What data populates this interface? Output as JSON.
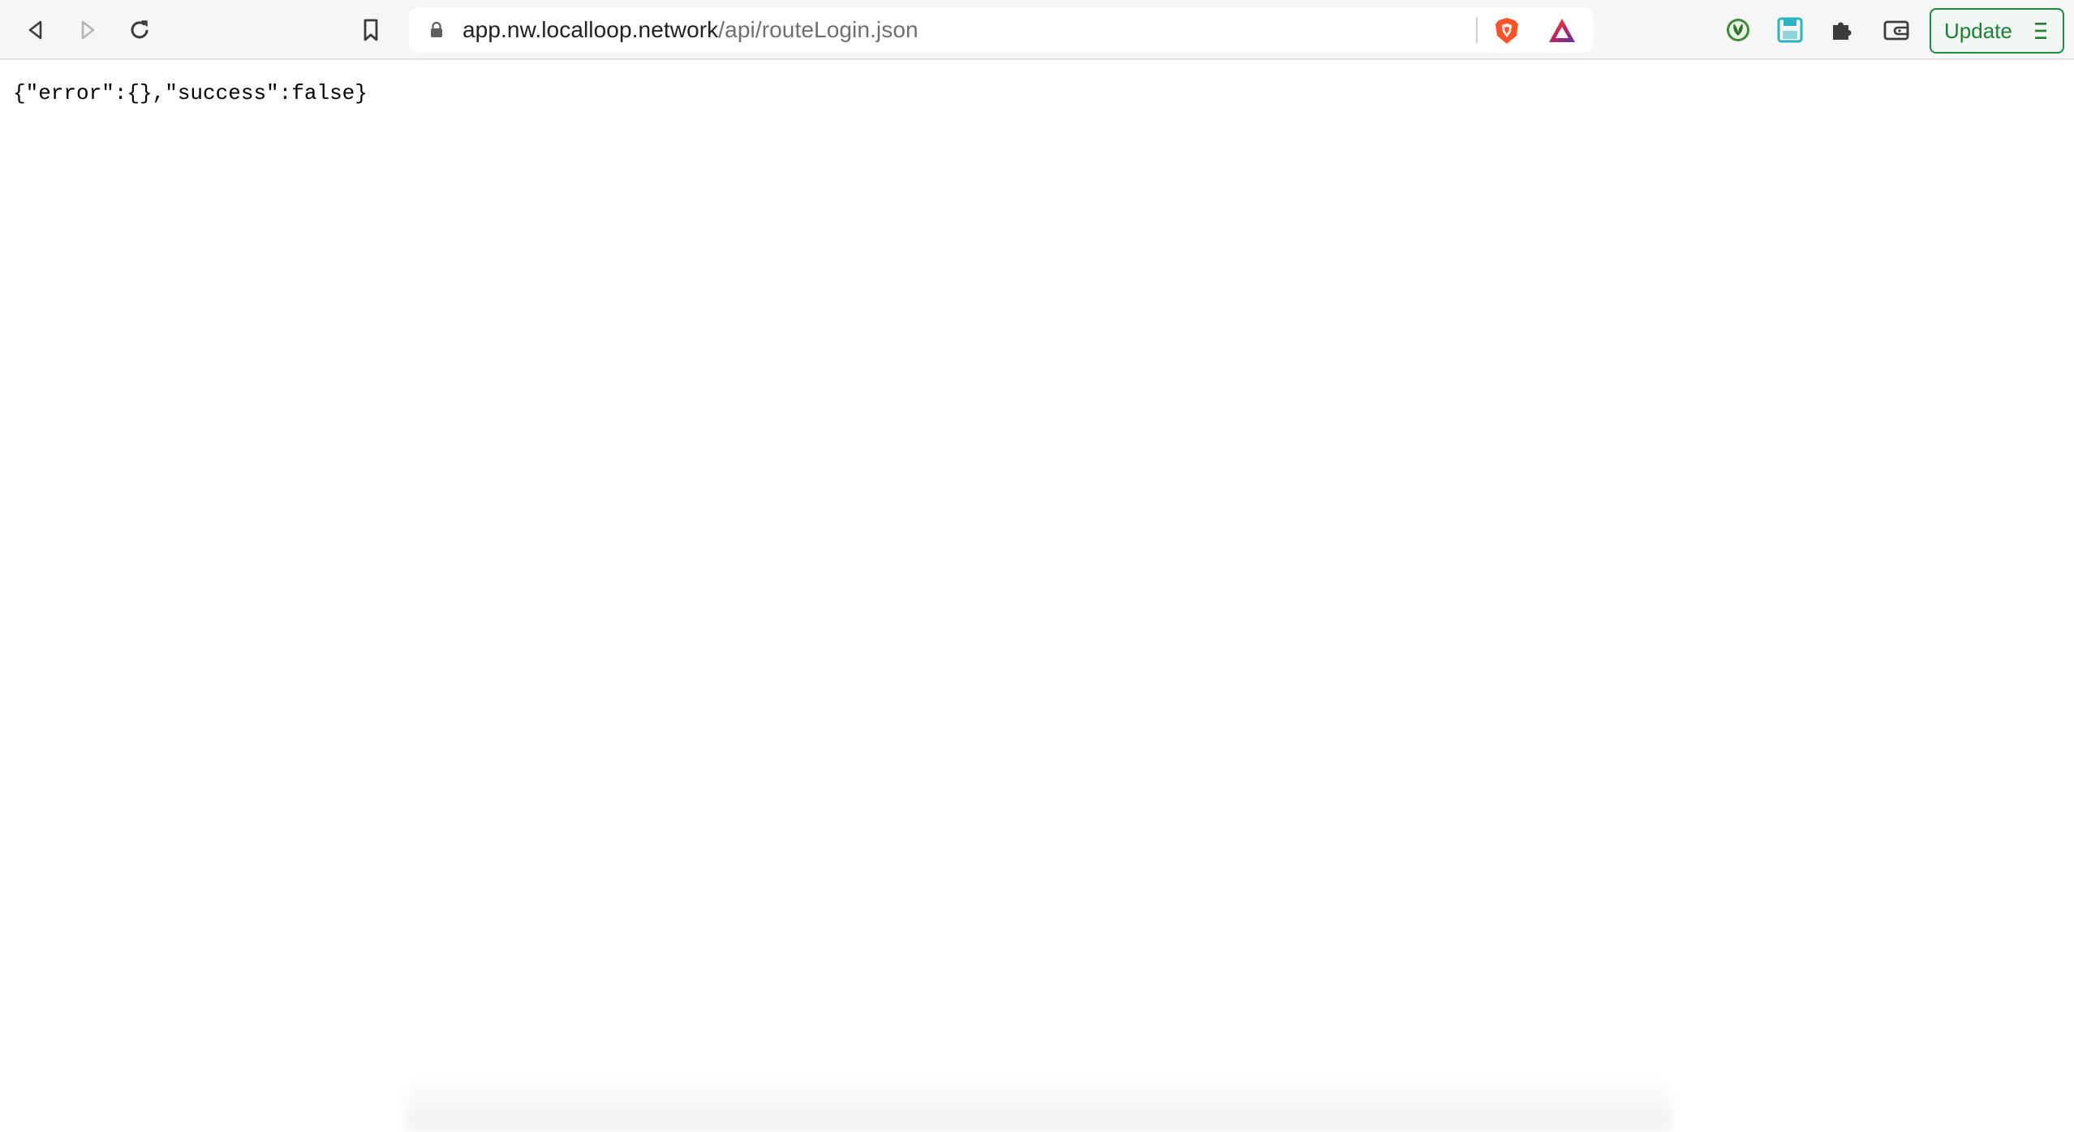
{
  "browser": {
    "url_host": "app.nw.localloop.network",
    "url_path": "/api/routeLogin.json",
    "update_label": "Update",
    "icons": {
      "back": "back-arrow-icon",
      "forward": "forward-arrow-icon",
      "reload": "reload-icon",
      "bookmark": "bookmark-icon",
      "lock": "lock-icon",
      "shield": "brave-shield-icon",
      "rewards": "brave-rewards-icon",
      "extension1": "green-extension-icon",
      "extension2": "save-extension-icon",
      "extensions": "puzzle-icon",
      "wallet": "wallet-icon",
      "menu": "hamburger-menu-icon"
    },
    "colors": {
      "update_accent": "#1e8e3e",
      "shield": "#fb542b",
      "save_ext": "#2bb3c0"
    }
  },
  "page": {
    "json_text": "{\"error\":{},\"success\":false}"
  }
}
